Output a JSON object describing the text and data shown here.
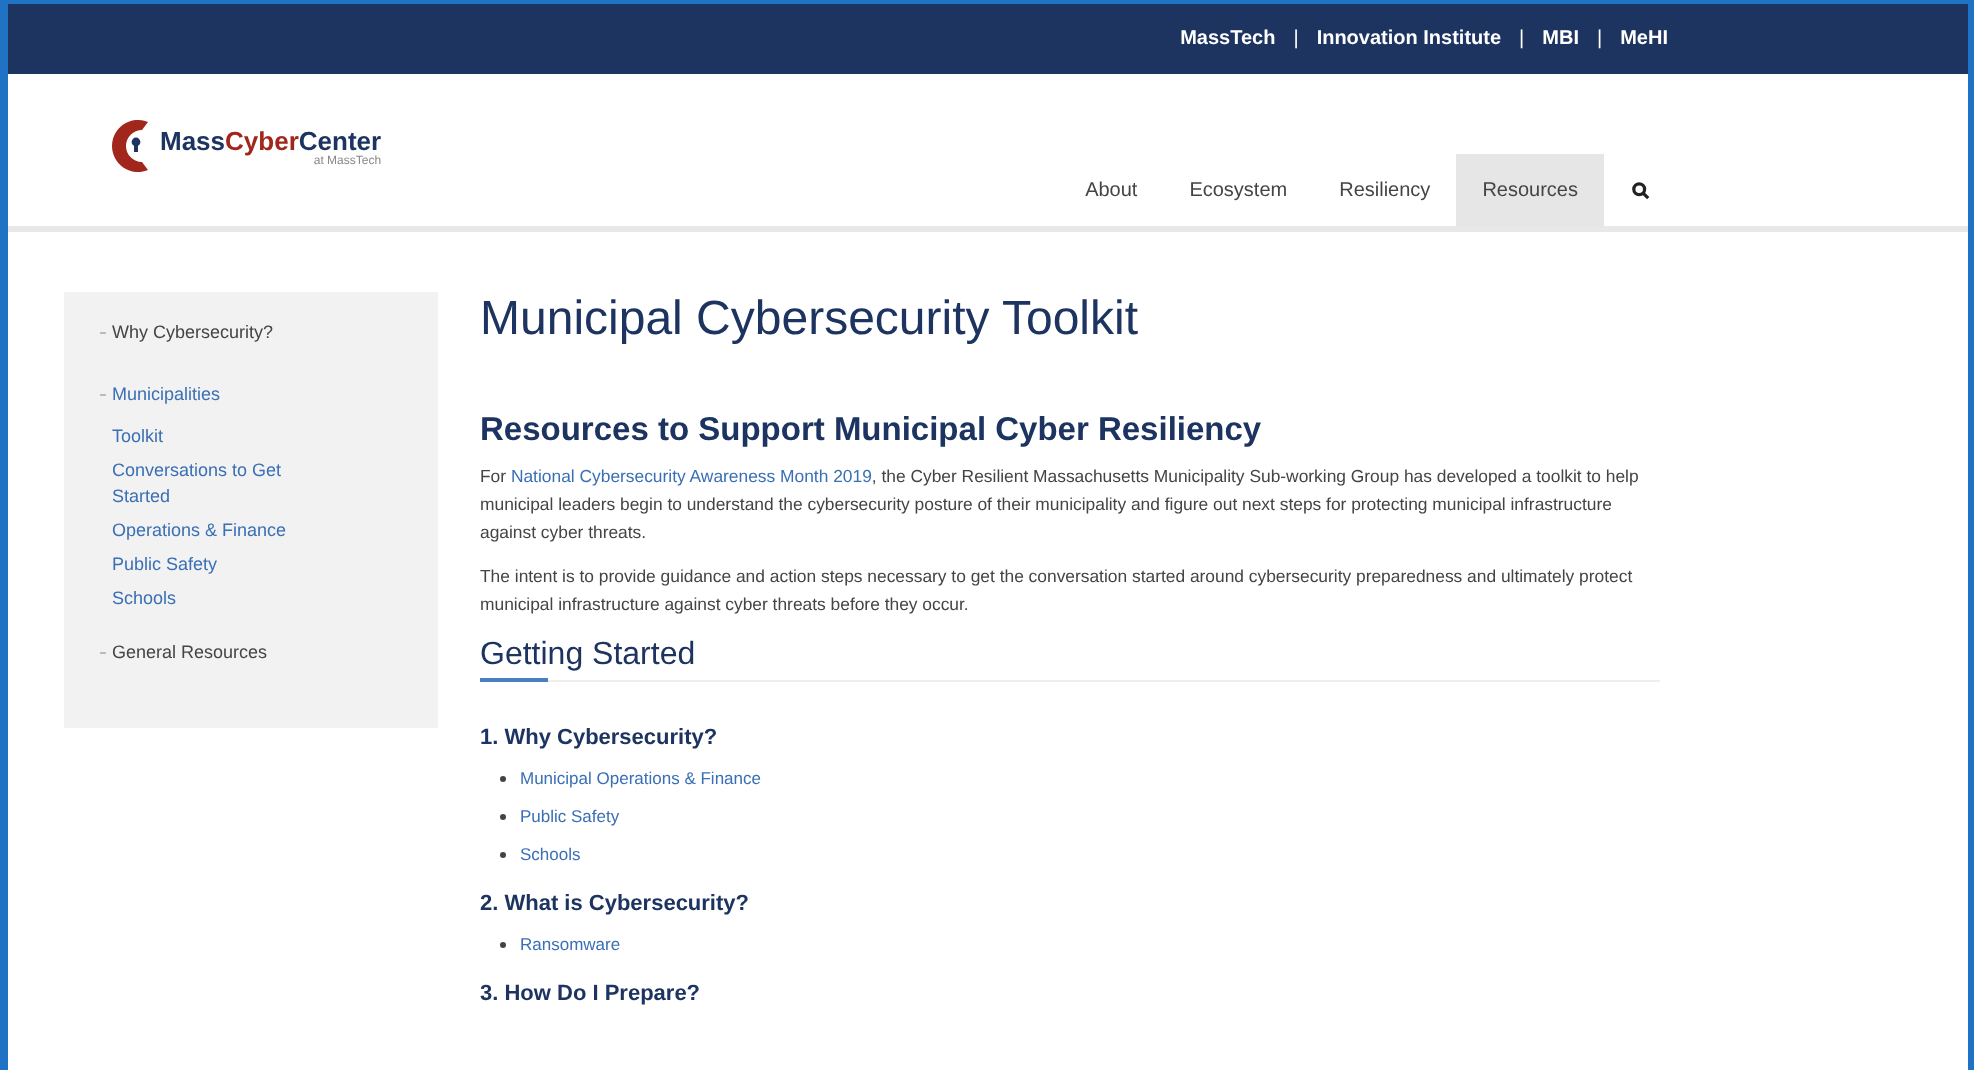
{
  "top_links": [
    "MassTech",
    "Innovation Institute",
    "MBI",
    "MeHI"
  ],
  "top_separator": "|",
  "logo": {
    "parts": [
      {
        "text": "Mass",
        "color": "#1d3461"
      },
      {
        "text": "Cyber",
        "color": "#a1271c"
      },
      {
        "text": "Center",
        "color": "#1d3461"
      }
    ],
    "tagline": "at MassTech"
  },
  "nav": [
    {
      "label": "About",
      "selected": false
    },
    {
      "label": "Ecosystem",
      "selected": false
    },
    {
      "label": "Resiliency",
      "selected": false
    },
    {
      "label": "Resources",
      "selected": true
    }
  ],
  "sidebar": {
    "items": [
      {
        "label": "Why Cybersecurity?",
        "expanded": false
      },
      {
        "label": "Municipalities",
        "expanded": true,
        "children": [
          {
            "label": "Toolkit"
          },
          {
            "label": "Conversations to Get Started"
          },
          {
            "label": "Operations & Finance"
          },
          {
            "label": "Public Safety"
          },
          {
            "label": "Schools"
          }
        ]
      },
      {
        "label": "General Resources",
        "expanded": false
      }
    ]
  },
  "page_title": "Municipal Cybersecurity Toolkit",
  "section_title": "Resources to Support Municipal Cyber Resiliency",
  "intro": {
    "before": "For ",
    "link": "National Cybersecurity Awareness Month 2019",
    "after": ", the Cyber Resilient Massachusetts Municipality Sub-working Group has developed a toolkit to help municipal leaders begin to understand the cybersecurity posture of their municipality and figure out next steps for protecting municipal infrastructure against cyber threats."
  },
  "paragraph": "The intent is to provide guidance and action steps necessary to get the conversation started around cybersecurity preparedness and ultimately protect municipal infrastructure against cyber threats before they occur.",
  "subheading": "Getting Started",
  "steps": [
    {
      "title": "1. Why Cybersecurity?",
      "links": [
        "Municipal Operations & Finance",
        "Public Safety",
        "Schools"
      ]
    },
    {
      "title": "2. What is Cybersecurity?",
      "links": [
        "Ransomware"
      ]
    },
    {
      "title": "3. How Do I Prepare?"
    }
  ]
}
